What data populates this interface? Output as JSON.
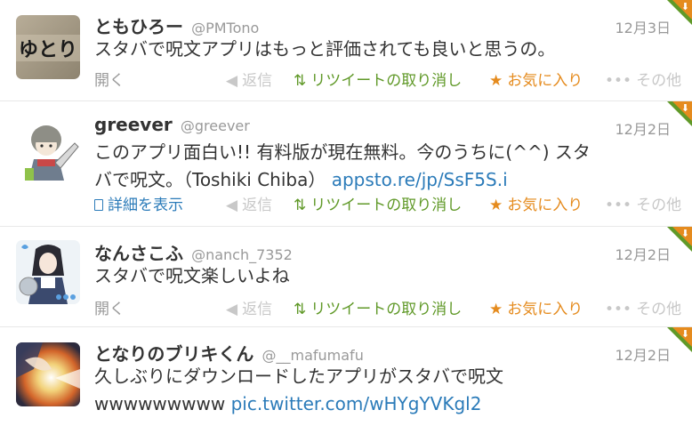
{
  "actions": {
    "open": "開く",
    "details": "詳細を表示",
    "reply": "返信",
    "retweet_undo": "リツイートの取り消し",
    "favorite": "お気に入り",
    "more": "その他"
  },
  "icons": {
    "reply": "reply-arrow-icon",
    "retweet": "retweet-icon",
    "favorite": "star-icon",
    "more": "ellipsis-icon",
    "details": "document-icon"
  },
  "colors": {
    "retweet": "#609928",
    "favorite": "#e58b1e",
    "link": "#2b7bb9"
  },
  "tweets": [
    {
      "name": "ともひろー",
      "handle": "@PMTono",
      "time": "12月3日",
      "text": "スタバで呪文アプリはもっと評価されても良いと思うの。",
      "avatar_text": "ゆとり"
    },
    {
      "name": "greever",
      "handle": "@greever",
      "time": "12月2日",
      "text_line1": "このアプリ面白い!! 有料版が現在無料。今のうちに(^^) スタ",
      "text_line2": "バで呪文。（Toshiki Chiba）",
      "link": "appsto.re/jp/SsF5S.i"
    },
    {
      "name": "なんさこふ",
      "handle": "@nanch_7352",
      "time": "12月2日",
      "text": "スタバで呪文楽しいよね"
    },
    {
      "name": "となりのブリキくん",
      "handle": "@__mafumafu",
      "time": "12月2日",
      "text_line1": "久しぶりにダウンロードしたアプリがスタバで呪文",
      "text_line2": "wwwwwwwww",
      "link": "pic.twitter.com/wHYgYVKgl2"
    }
  ]
}
